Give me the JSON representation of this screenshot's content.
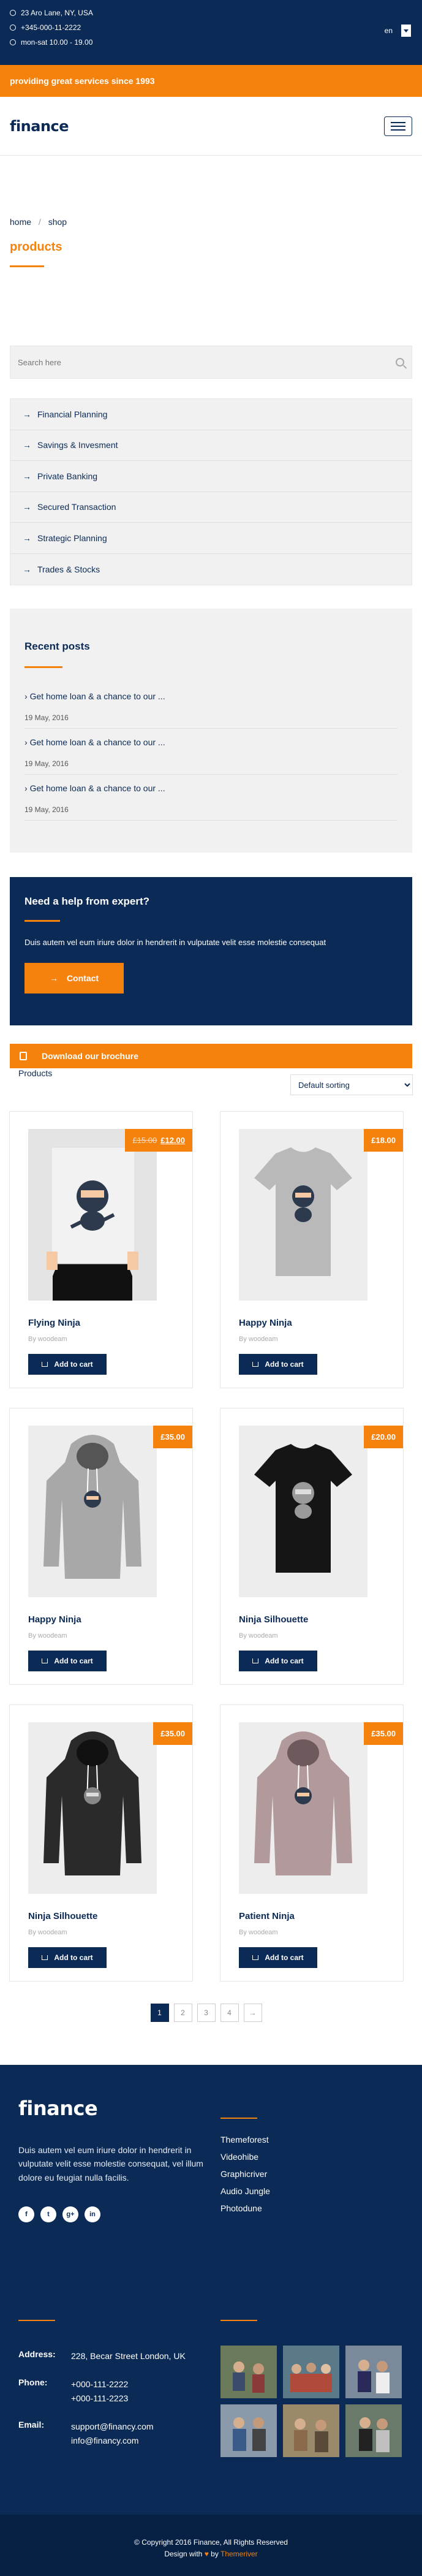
{
  "topbar": {
    "address": "23 Aro Lane, NY, USA",
    "phone": "+345-000-11-2222",
    "hours": "mon-sat 10.00 - 19.00",
    "language": "en"
  },
  "tagline": "providing great services since 1993",
  "logo": "finance",
  "breadcrumb": {
    "home": "home",
    "sep": "/",
    "current": "shop"
  },
  "page_title": "products",
  "search": {
    "placeholder": "Search here"
  },
  "categories": [
    {
      "label": "Financial Planning"
    },
    {
      "label": "Savings & Invesment"
    },
    {
      "label": "Private Banking"
    },
    {
      "label": "Secured Transaction"
    },
    {
      "label": "Strategic Planning"
    },
    {
      "label": "Trades & Stocks"
    }
  ],
  "recent_posts": {
    "title": "Recent posts",
    "items": [
      {
        "title": "Get home loan & a chance to our ...",
        "date": "19 May, 2016"
      },
      {
        "title": "Get home loan & a chance to our ...",
        "date": "19 May, 2016"
      },
      {
        "title": "Get home loan & a chance to our ...",
        "date": "19 May, 2016"
      }
    ]
  },
  "help": {
    "title": "Need a help from expert?",
    "text": "Duis autem vel eum iriure dolor in hendrerit in vulputate velit esse molestie consequat",
    "button": "Contact"
  },
  "brochure": "Download our brochure",
  "products_header": {
    "label": "Products",
    "sort_options": [
      "Default sorting"
    ]
  },
  "products": [
    {
      "name": "Flying Ninja",
      "by": "By woodeam",
      "old_price": "£15.00",
      "price": "£12.00",
      "button": "Add to cart",
      "type": "poster"
    },
    {
      "name": "Happy Ninja",
      "by": "By woodeam",
      "old_price": "",
      "price": "£18.00",
      "button": "Add to cart",
      "type": "tshirt-grey"
    },
    {
      "name": "Happy Ninja",
      "by": "By woodeam",
      "old_price": "",
      "price": "£35.00",
      "button": "Add to cart",
      "type": "hoodie-grey"
    },
    {
      "name": "Ninja Silhouette",
      "by": "By woodeam",
      "old_price": "",
      "price": "£20.00",
      "button": "Add to cart",
      "type": "tshirt-black"
    },
    {
      "name": "Ninja Silhouette",
      "by": "By woodeam",
      "old_price": "",
      "price": "£35.00",
      "button": "Add to cart",
      "type": "hoodie-black"
    },
    {
      "name": "Patient Ninja",
      "by": "By woodeam",
      "old_price": "",
      "price": "£35.00",
      "button": "Add to cart",
      "type": "hoodie-pink"
    }
  ],
  "pagination": [
    "1",
    "2",
    "3",
    "4",
    "→"
  ],
  "footer": {
    "logo": "finance",
    "description": "Duis autem vel eum iriure dolor in hendrerit in vulputate velit esse molestie consequat, vel illum dolore eu feugiat nulla facilis.",
    "social": [
      "f",
      "t",
      "g+",
      "in"
    ],
    "links": [
      "Themeforest",
      "Videohibe",
      "Graphicriver",
      "Audio Jungle",
      "Photodune"
    ],
    "address_label": "Address:",
    "address": "228, Becar Street London, UK",
    "phone_label": "Phone:",
    "phone1": "+000-111-2222",
    "phone2": "+000-111-2223",
    "email_label": "Email:",
    "email1": "support@financy.com",
    "email2": "info@financy.com"
  },
  "copyright": {
    "line1": "© Copyright 2016 Finance, All Rights Reserved",
    "design_with": "Design with",
    "by": "by",
    "brand": "Themeriver"
  },
  "colors": {
    "navy": "#0b2a55",
    "orange": "#f5820d"
  }
}
